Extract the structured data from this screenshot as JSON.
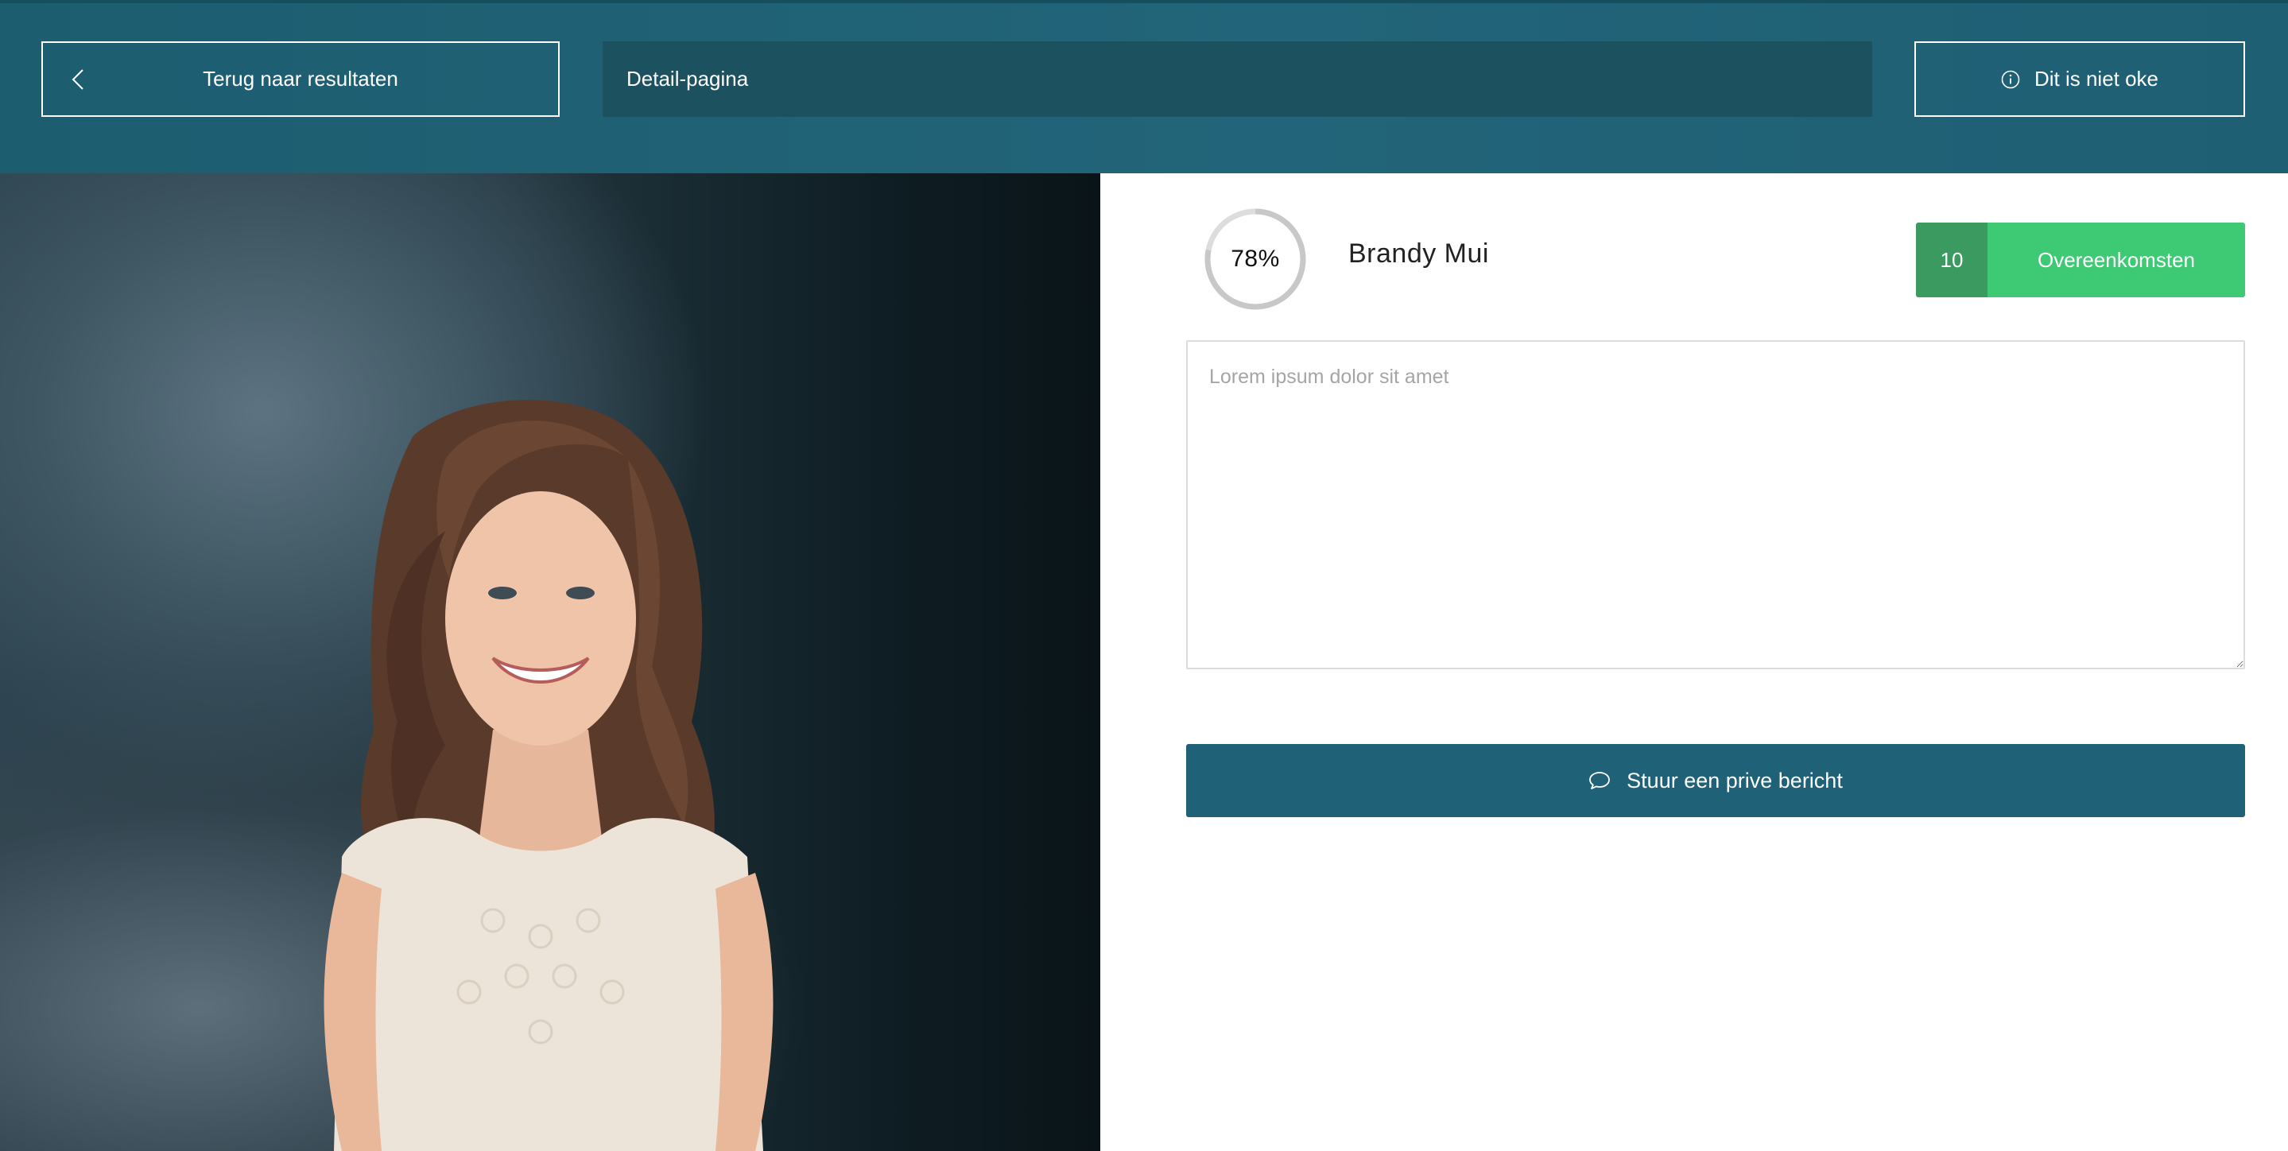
{
  "header": {
    "back_label": "Terug naar resultaten",
    "page_title": "Detail-pagina",
    "report_label": "Dit is niet oke"
  },
  "profile": {
    "match_percent_label": "78%",
    "match_percent": 78,
    "name": "Brandy Mui",
    "matches_count": "10",
    "matches_label": "Overeenkomsten"
  },
  "message": {
    "placeholder": "Lorem ipsum dolor sit amet",
    "value": "",
    "send_label": "Stuur een prive bericht"
  },
  "colors": {
    "header_bg": "#226479",
    "accent_green": "#3ec974",
    "accent_green_dark": "#3a9a5f",
    "primary_button": "#1f6277"
  },
  "icons": {
    "back": "chevron-left-icon",
    "report": "info-icon",
    "send": "chat-bubble-icon"
  }
}
